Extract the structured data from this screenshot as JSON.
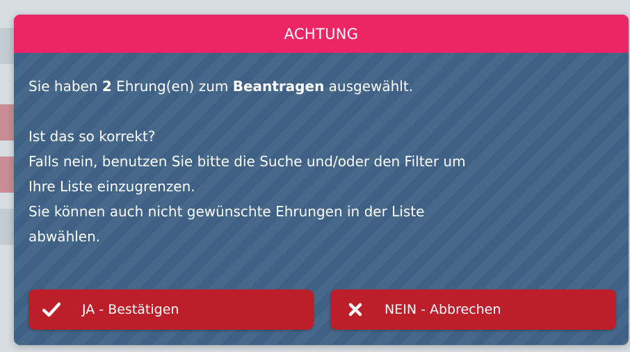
{
  "dialog": {
    "title": "ACHTUNG",
    "line1_prefix": "Sie haben ",
    "line1_count": "2",
    "line1_mid": " Ehrung(en) zum ",
    "line1_action": "Beantragen",
    "line1_suffix": " ausgewählt.",
    "question": "Ist das so korrekt?",
    "hint_line1": "Falls nein, benutzen Sie bitte die Suche und/oder den Filter um",
    "hint_line2": "Ihre Liste einzugrenzen.",
    "hint_line3": "Sie können auch nicht gewünschte Ehrungen in der Liste",
    "hint_line4": "abwählen."
  },
  "buttons": {
    "confirm_label": "JA - Bestätigen",
    "cancel_label": "NEIN - Abbrechen",
    "confirm_icon": "checkmark-icon",
    "cancel_icon": "close-icon"
  },
  "colors": {
    "header": "#ec2566",
    "body": "#3e6185",
    "button": "#bc1e2a"
  }
}
